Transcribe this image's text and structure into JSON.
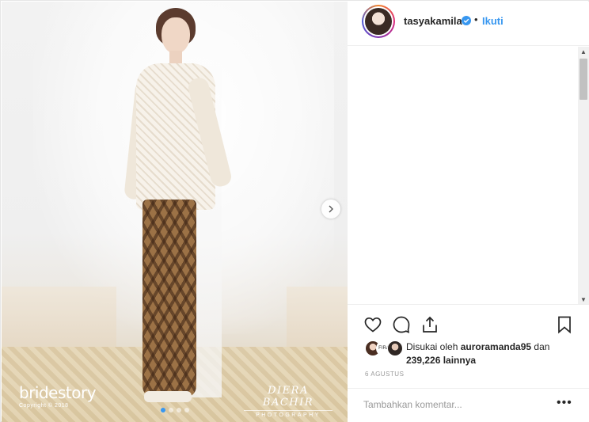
{
  "post": {
    "media": {
      "watermark_left": {
        "brand": "bridestory",
        "copyright": "Copyright © 2018"
      },
      "watermark_right": {
        "name": "DIERA BACHIR",
        "subtitle": "PHOTOGRAPHY"
      },
      "carousel": {
        "count": 4,
        "active_index": 0
      },
      "next_icon": "chevron-right-icon"
    },
    "header": {
      "username": "tasyakamila",
      "verified_icon": "verified-badge-icon",
      "separator": "•",
      "follow_label": "Ikuti"
    },
    "actions": {
      "like_icon": "heart-icon",
      "comment_icon": "comment-icon",
      "share_icon": "share-icon",
      "save_icon": "bookmark-icon"
    },
    "likes": {
      "prefix": "Disukai oleh ",
      "user": "auroramanda95",
      "conjunction": " dan",
      "count": "239,226 lainnya",
      "badge_text": "FIRA"
    },
    "date": "6 AGUSTUS",
    "comment": {
      "placeholder": "Tambahkan komentar...",
      "more_label": "•••"
    },
    "colors": {
      "accent": "#3897f0",
      "text": "#262626",
      "muted": "#999999",
      "border": "#efefef"
    }
  }
}
